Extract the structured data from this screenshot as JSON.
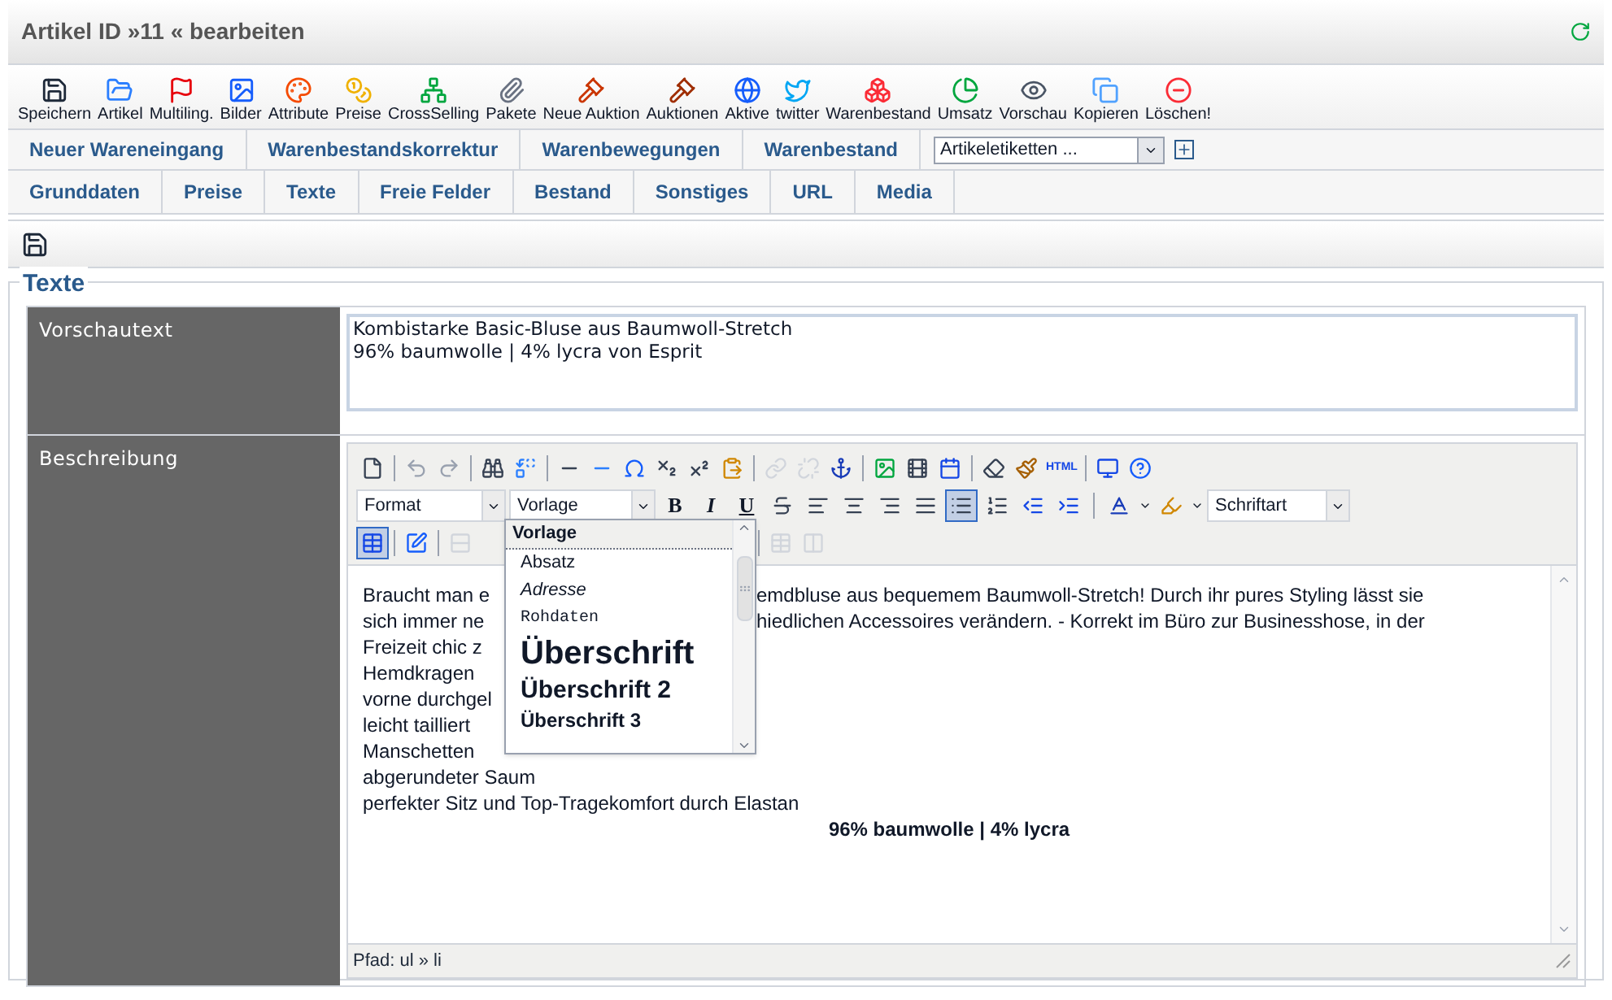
{
  "header": {
    "title": "Artikel ID »11 « bearbeiten"
  },
  "toolbar": [
    {
      "label": "Speichern"
    },
    {
      "label": "Artikel"
    },
    {
      "label": "Multiling."
    },
    {
      "label": "Bilder"
    },
    {
      "label": "Attribute"
    },
    {
      "label": "Preise"
    },
    {
      "label": "CrossSelling"
    },
    {
      "label": "Pakete"
    },
    {
      "label": "Neue Auktion"
    },
    {
      "label": "Auktionen"
    },
    {
      "label": "Aktive"
    },
    {
      "label": "twitter"
    },
    {
      "label": "Warenbestand"
    },
    {
      "label": "Umsatz"
    },
    {
      "label": "Vorschau"
    },
    {
      "label": "Kopieren"
    },
    {
      "label": "Löschen!"
    }
  ],
  "stock_links": [
    "Neuer Wareneingang",
    "Warenbestandskorrektur",
    "Warenbewegungen",
    "Warenbestand"
  ],
  "label_select": {
    "value": "Artikeletiketten ..."
  },
  "tabs": [
    "Grunddaten",
    "Preise",
    "Texte",
    "Freie Felder",
    "Bestand",
    "Sonstiges",
    "URL",
    "Media"
  ],
  "section": {
    "legend": "Texte"
  },
  "preview": {
    "label": "Vorschautext",
    "value": "Kombistarke Basic-Bluse aus Baumwoll-Stretch\n96% baumwolle | 4% lycra von Esprit"
  },
  "description": {
    "label": "Beschreibung",
    "editor": {
      "html_button": "HTML",
      "format_select": "Format",
      "style_select": "Vorlage",
      "font_select": "Schriftart",
      "text_buttons": [
        "B",
        "I",
        "U"
      ],
      "bullet_list": {
        "selected": true
      },
      "table_button": {
        "selected": true
      },
      "lines": [
        {
          "left": "Braucht man e",
          "right": "emdbluse aus bequemem Baumwoll-Stretch! Durch ihr pures Styling lässt sie"
        },
        {
          "left": "sich immer ne",
          "right": "hiedlichen Accessoires verändern. - Korrekt im Büro zur Businesshose, in der"
        },
        {
          "left": "Freizeit chic z"
        },
        {
          "left": "Hemdkragen"
        },
        {
          "left": "vorne durchgel"
        },
        {
          "left": "leicht tailliert"
        },
        {
          "left": "Manschetten"
        },
        {
          "left": "abgerundeter Saum"
        },
        {
          "left": "perfekter Sitz und Top-Tragekomfort durch Elastan"
        }
      ],
      "closing": "96% baumwolle | 4% lycra",
      "path": "Pfad: ul » li",
      "style_menu": {
        "title": "Vorlage",
        "items": [
          {
            "kind": "paragraph",
            "label": "Absatz"
          },
          {
            "kind": "address",
            "label": "Adresse"
          },
          {
            "kind": "raw",
            "label": "Rohdaten"
          },
          {
            "kind": "h1",
            "label": "Überschrift"
          },
          {
            "kind": "h2",
            "label": "Überschrift 2"
          },
          {
            "kind": "h3",
            "label": "Überschrift 3"
          }
        ]
      }
    }
  }
}
